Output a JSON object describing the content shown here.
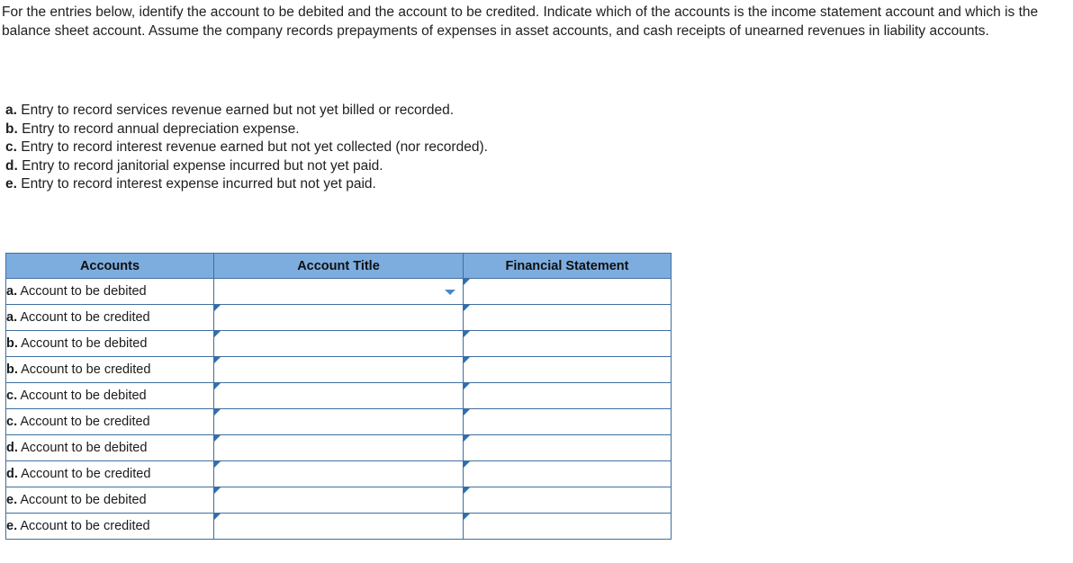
{
  "intro": {
    "text": "For the entries below, identify the account to be debited and the account to be credited. Indicate which of the accounts is the income statement account and which is the balance sheet account. Assume the company records prepayments of expenses in asset accounts, and cash receipts of unearned revenues in liability accounts."
  },
  "entries": [
    {
      "label": "a.",
      "text": "Entry to record services revenue earned but not yet billed or recorded."
    },
    {
      "label": "b.",
      "text": "Entry to record annual depreciation expense."
    },
    {
      "label": "c.",
      "text": "Entry to record interest revenue earned but not yet collected (nor recorded)."
    },
    {
      "label": "d.",
      "text": "Entry to record janitorial expense incurred but not yet paid."
    },
    {
      "label": "e.",
      "text": "Entry to record interest expense incurred but not yet paid."
    }
  ],
  "table": {
    "headers": {
      "accounts": "Accounts",
      "account_title": "Account Title",
      "financial_statement": "Financial Statement"
    },
    "rows": [
      {
        "label": "a.",
        "text": "Account to be debited",
        "account_title": "",
        "financial_statement": "",
        "active": true
      },
      {
        "label": "a.",
        "text": "Account to be credited",
        "account_title": "",
        "financial_statement": "",
        "active": false
      },
      {
        "label": "b.",
        "text": "Account to be debited",
        "account_title": "",
        "financial_statement": "",
        "active": false
      },
      {
        "label": "b.",
        "text": "Account to be credited",
        "account_title": "",
        "financial_statement": "",
        "active": false
      },
      {
        "label": "c.",
        "text": "Account to be debited",
        "account_title": "",
        "financial_statement": "",
        "active": false
      },
      {
        "label": "c.",
        "text": "Account to be credited",
        "account_title": "",
        "financial_statement": "",
        "active": false
      },
      {
        "label": "d.",
        "text": "Account to be debited",
        "account_title": "",
        "financial_statement": "",
        "active": false
      },
      {
        "label": "d.",
        "text": "Account to be credited",
        "account_title": "",
        "financial_statement": "",
        "active": false
      },
      {
        "label": "e.",
        "text": "Account to be debited",
        "account_title": "",
        "financial_statement": "",
        "active": false
      },
      {
        "label": "e.",
        "text": "Account to be credited",
        "account_title": "",
        "financial_statement": "",
        "active": false
      }
    ]
  },
  "colors": {
    "header_fill": "#7dadde",
    "border": "#3f6f9f",
    "marker": "#2f6fb0"
  }
}
